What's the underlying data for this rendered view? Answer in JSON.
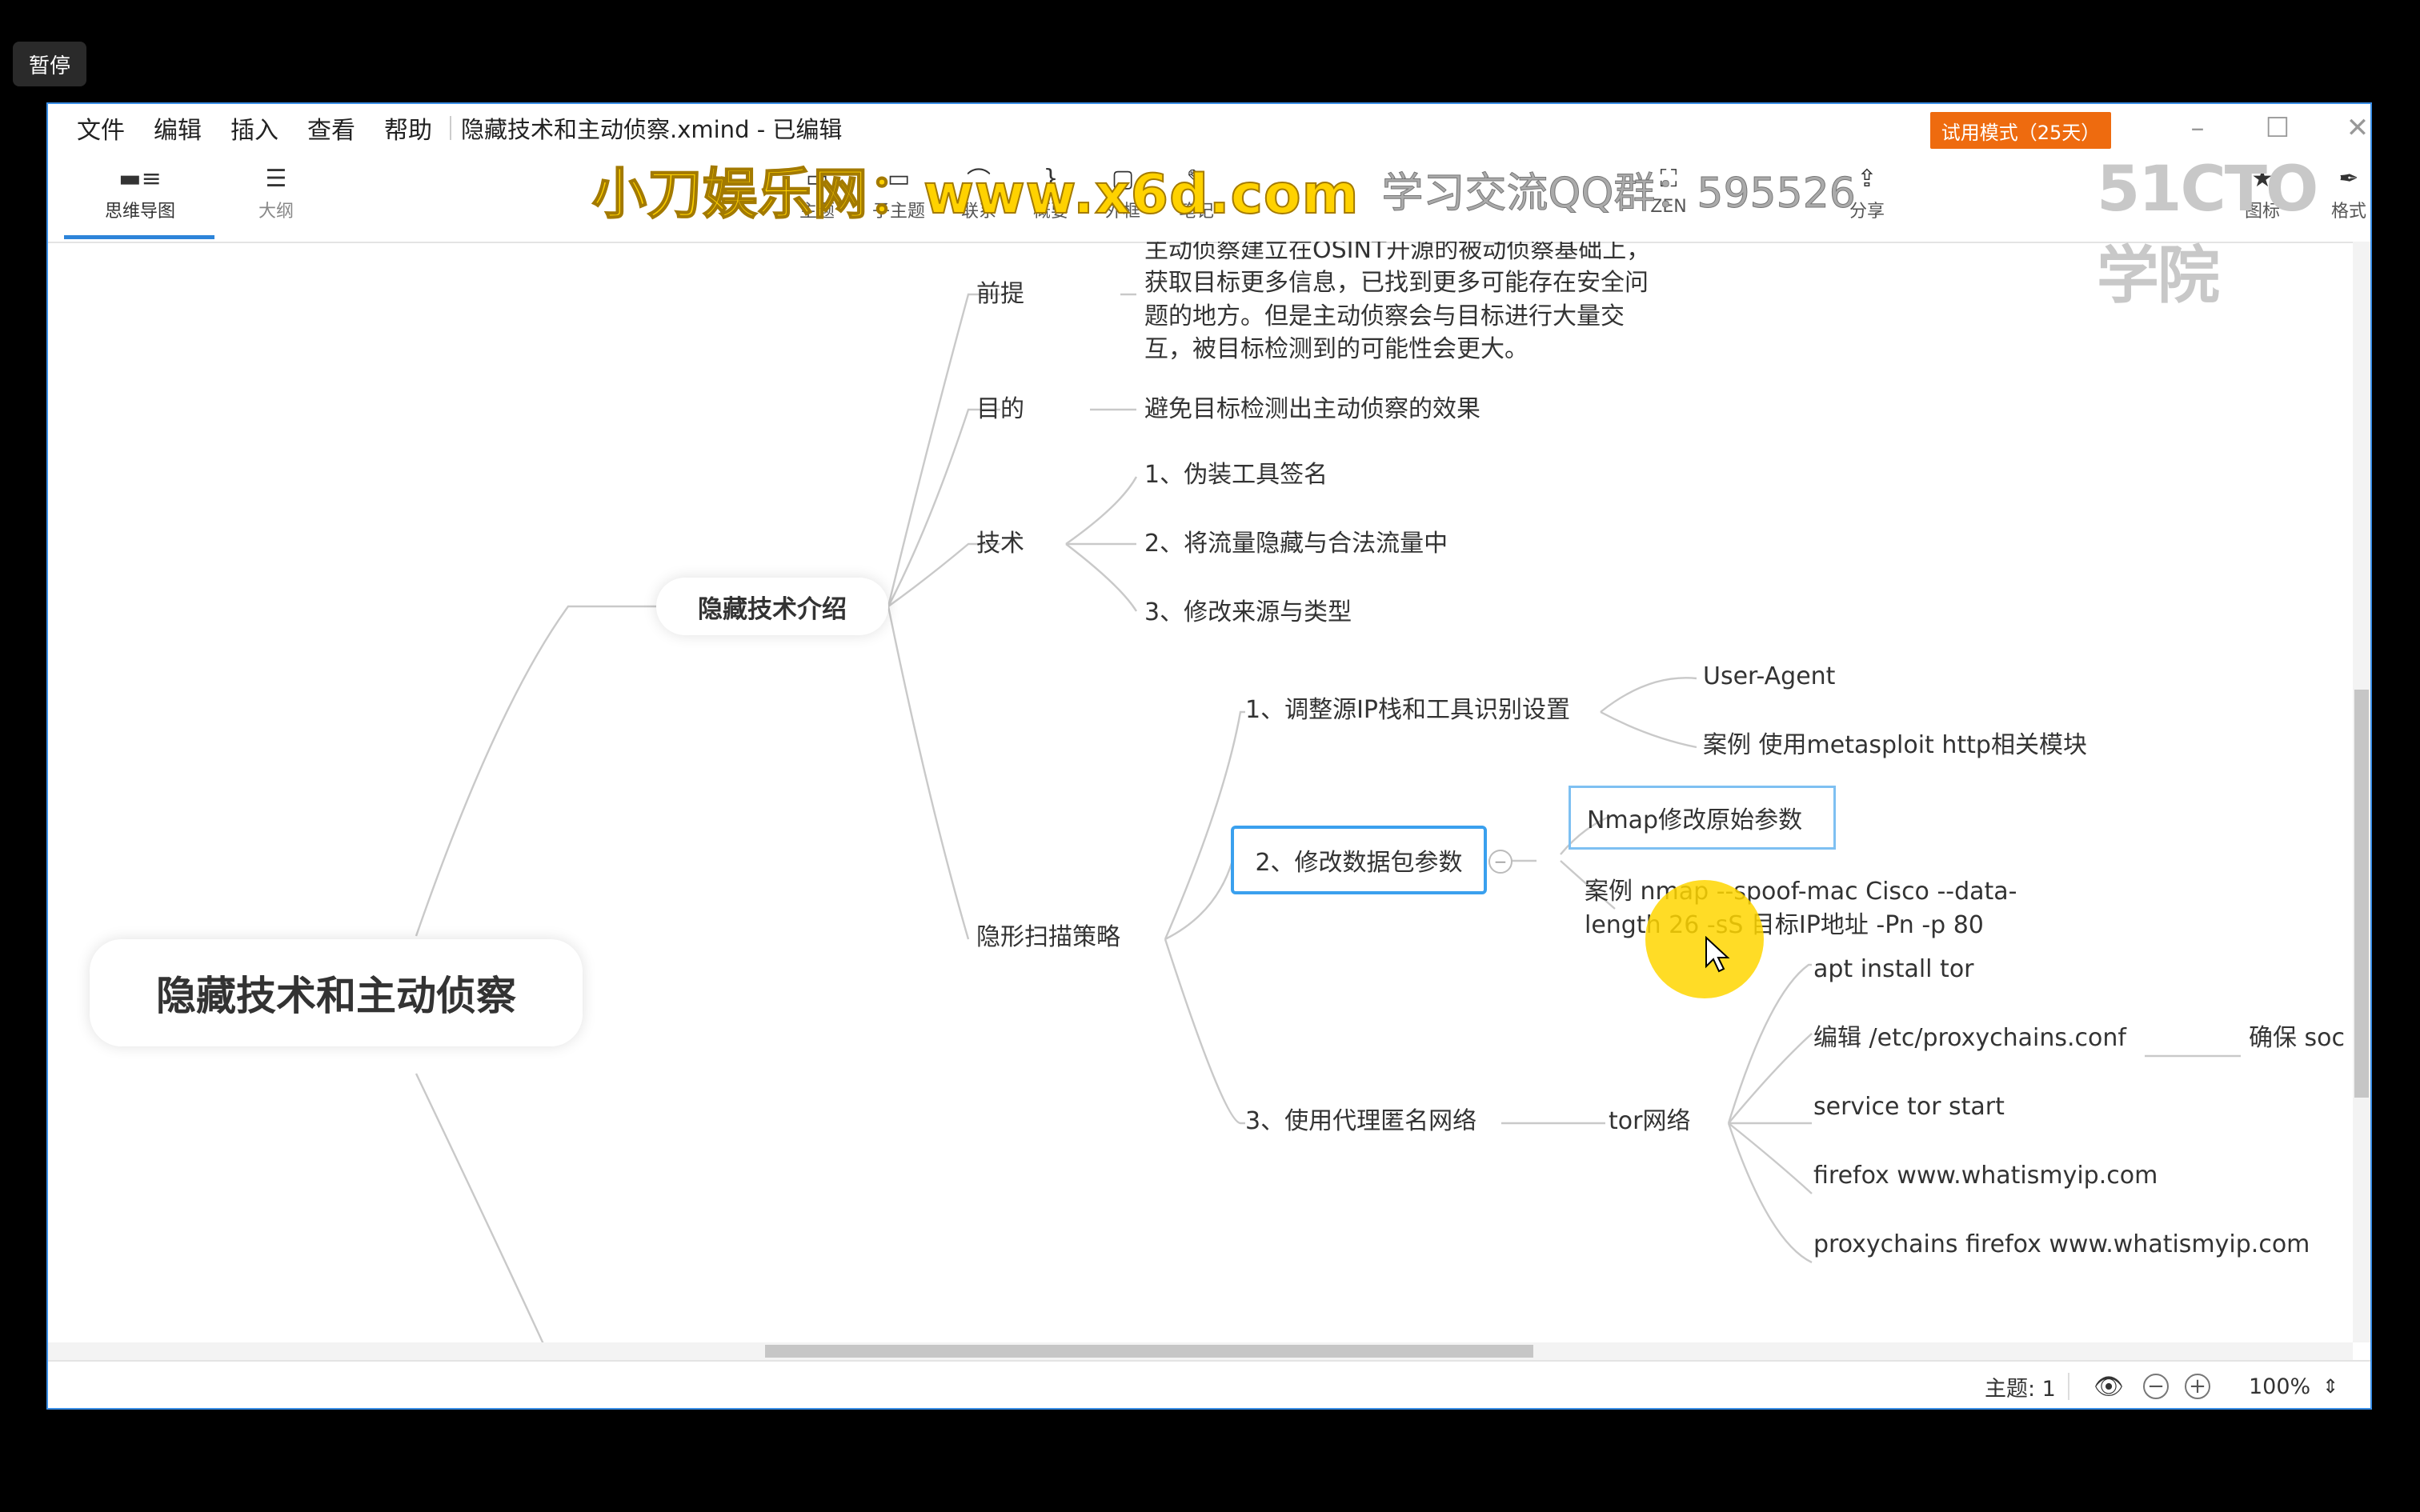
{
  "overlay": {
    "pause_label": "暂停"
  },
  "menu": [
    "文件",
    "编辑",
    "插入",
    "查看",
    "帮助"
  ],
  "doc_title": "隐藏技术和主动侦察.xmind - 已编辑",
  "trial_badge": "试用模式（25天）",
  "toolbar": {
    "mindmap": "思维导图",
    "outline": "大纲",
    "topic": "主题",
    "subtopic": "子主题",
    "relation": "联系",
    "summary": "概要",
    "boundary": "外框",
    "note": "笔记",
    "zen": "ZEN",
    "share": "分享",
    "icons": "图标",
    "format": "格式"
  },
  "watermark": {
    "main": "小刀娱乐网：www.x6d.com",
    "sub": "学习交流QQ群：595526",
    "logo": "51CTO学院"
  },
  "mindmap": {
    "root": "隐藏技术和主动侦察",
    "branch1": "隐藏技术介绍",
    "premise_label": "前提",
    "premise_text": [
      "主动侦察建立在OSINT开源的被动侦察基础上，",
      "获取目标更多信息，已找到更多可能存在安全问",
      "题的地方。但是主动侦察会与目标进行大量交",
      "互，被目标检测到的可能性会更大。"
    ],
    "purpose_label": "目的",
    "purpose_text": "避免目标检测出主动侦察的效果",
    "tech_label": "技术",
    "tech_items": [
      "1、伪装工具签名",
      "2、将流量隐藏与合法流量中",
      "3、修改来源与类型"
    ],
    "stealth_label": "隐形扫描策略",
    "s1": "1、调整源IP栈和工具识别设置",
    "s1_children": [
      "User-Agent",
      "案例 使用metasploit http相关模块"
    ],
    "s2": "2、修改数据包参数",
    "s2_child1": "Nmap修改原始参数",
    "s2_child2": [
      "案例  nmap --spoof-mac Cisco --data-",
      "length 26 -sS 目标IP地址 -Pn -p 80"
    ],
    "s3": "3、使用代理匿名网络",
    "tor": "tor网络",
    "tor_children": [
      "apt install tor",
      "编辑 /etc/proxychains.conf",
      "service tor start",
      "firefox www.whatismyip.com",
      "proxychains firefox www.whatismyip.com"
    ],
    "tor_grandchild": "确保 soc"
  },
  "status": {
    "topic_count": "主题: 1",
    "zoom": "100%"
  }
}
